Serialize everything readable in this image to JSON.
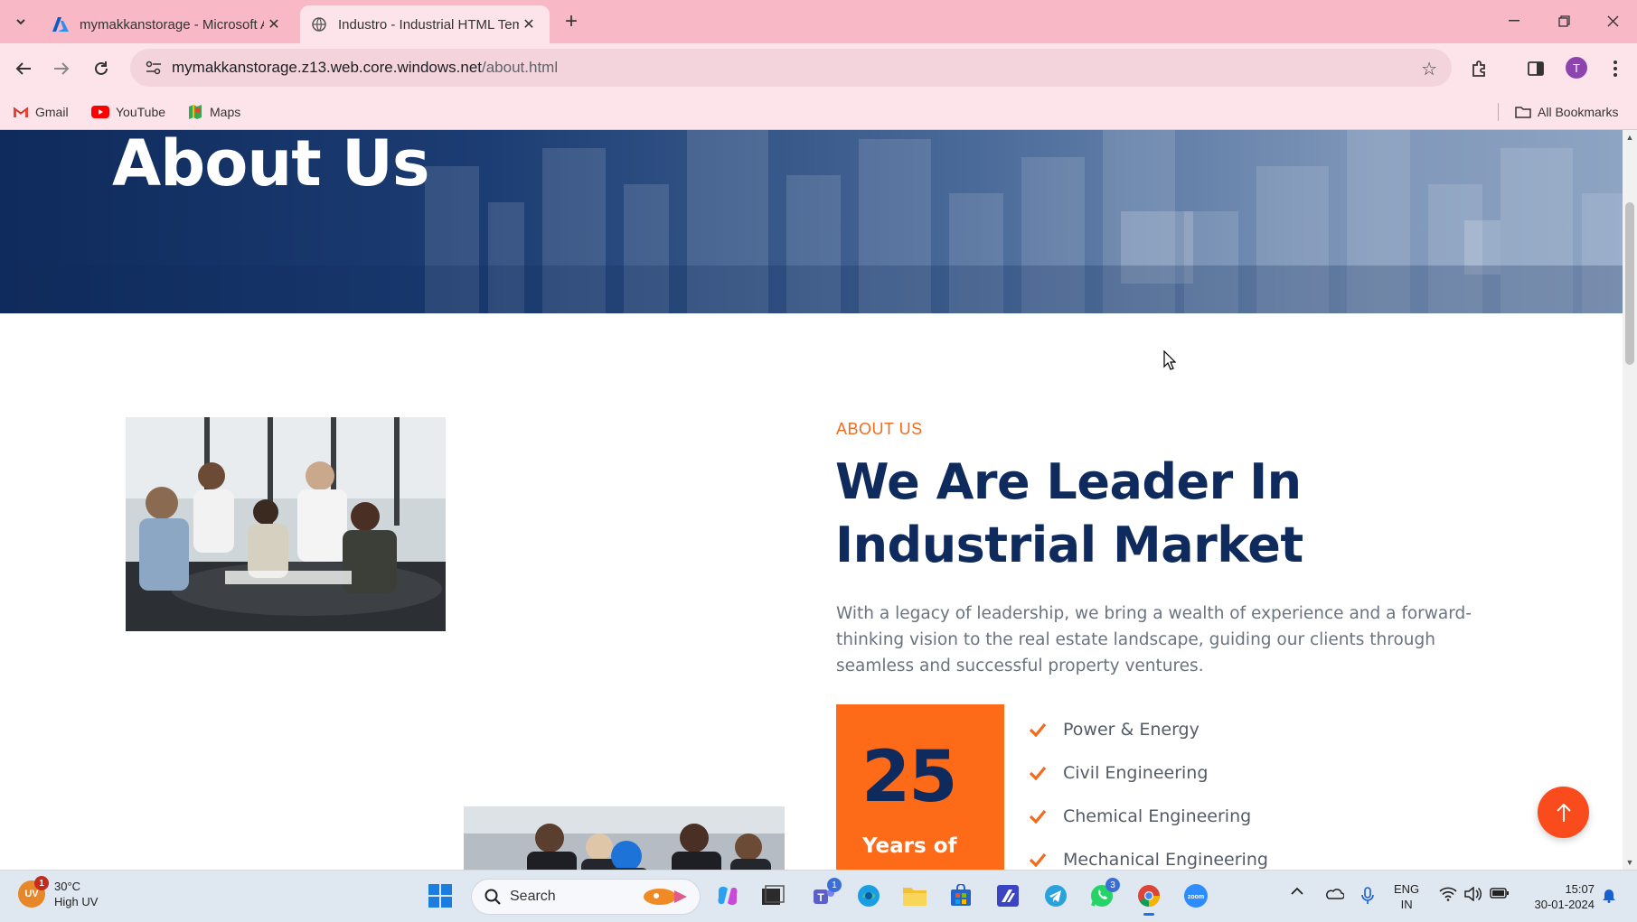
{
  "browser": {
    "tabs": [
      {
        "title": "mymakkanstorage - Microsoft Azure",
        "active": false
      },
      {
        "title": "Industro - Industrial HTML Template",
        "active": true
      }
    ],
    "url_host": "mymakkanstorage.z13.web.core.windows.net",
    "url_path": "/about.html",
    "avatar_initial": "T",
    "bookmarks": [
      {
        "label": "Gmail",
        "icon": "gmail-icon"
      },
      {
        "label": "YouTube",
        "icon": "youtube-icon"
      },
      {
        "label": "Maps",
        "icon": "maps-icon"
      }
    ],
    "all_bookmarks_label": "All Bookmarks"
  },
  "page": {
    "hero_title": "About Us",
    "eyebrow": "ABOUT US",
    "heading_line1": "We Are Leader In",
    "heading_line2": "Industrial Market",
    "paragraph": "With a legacy of leadership, we bring a wealth of experience and a forward-thinking vision to the real estate landscape, guiding our clients through seamless and successful property ventures.",
    "years_number": "25",
    "years_label": "Years of",
    "services": [
      "Power & Energy",
      "Civil Engineering",
      "Chemical Engineering",
      "Mechanical Engineering"
    ],
    "accent_color": "#fe6b18",
    "navy_color": "#0f2a5c"
  },
  "taskbar": {
    "weather_temp": "30°C",
    "weather_desc": "High UV",
    "weather_badge": "UV",
    "weather_alert_count": "1",
    "search_placeholder": "Search",
    "teams_badge": "1",
    "whatsapp_badge": "3",
    "language_line1": "ENG",
    "language_line2": "IN",
    "time": "15:07",
    "date": "30-01-2024"
  }
}
